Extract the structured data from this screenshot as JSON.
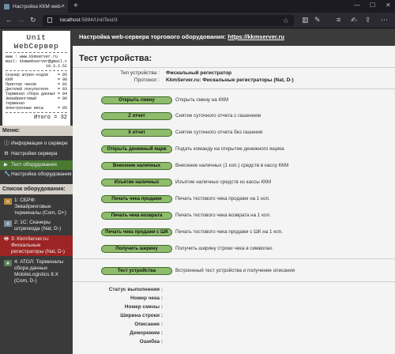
{
  "browser": {
    "tab_title": "Настройка ККМ web-се",
    "url_host": "localhost",
    "url_path": ":5894/UnitTest/3"
  },
  "header": {
    "prefix": "Настройка web-сервера торгового оборудования: ",
    "link": "https://kkmserver.ru"
  },
  "receipt": {
    "title": "Unit WebСервер",
    "lines": [
      "www : www.kkmserver.ru",
      "mail: kkmwebserver@gmail.com"
    ],
    "version": "10.3.2.51",
    "rows": [
      {
        "label": "Сканер штрих-кодов",
        "value": "= 05"
      },
      {
        "label": "ККМ",
        "value": "= 08"
      },
      {
        "label": "Принтер чеков",
        "value": "= 01"
      },
      {
        "label": "Дисплей покупателя",
        "value": "= 03"
      },
      {
        "label": "Терминал сбора данных",
        "value": "= 04"
      },
      {
        "label": "Эквайринговый терминал",
        "value": "= 06"
      },
      {
        "label": "Электронные весы",
        "value": "= 05"
      }
    ],
    "total": "Итого = 32"
  },
  "sidebar": {
    "menu_title": "Меню:",
    "menu_items": [
      {
        "label": "Информация о сервере",
        "icon": "info"
      },
      {
        "label": "Настройки сервера",
        "icon": "gear"
      },
      {
        "label": "Тест оборудования",
        "icon": "play"
      },
      {
        "label": "Настройка оборудования",
        "icon": "wrench"
      }
    ],
    "equipment_title": "Список оборудования:",
    "equipment": [
      {
        "label": "1: СБРФ: Эквайринговые терминалы (Com, D+)"
      },
      {
        "label": "2: 1С: Сканеры штрихкода (Nat, D-)"
      },
      {
        "label": "3: KkmServer.ru: Фискальные регистраторы (Nat, D-)"
      },
      {
        "label": "4: АТОЛ: Терминалы сбора данных MobileLogistics 8.X (Com, D-)"
      }
    ]
  },
  "main": {
    "title": "Тест устройства:",
    "device_type_label": "Тип устройства :",
    "device_type_value": "Фискальный регистратор",
    "protocol_label": "Протокол :",
    "protocol_value": "KkmServer.ru: Фискальные регистраторы (Nat, D-)",
    "commands": [
      {
        "label": "Открыть смену",
        "desc": "Открыть смену на ККМ"
      },
      {
        "label": "Z отчет",
        "desc": "Снятие суточного отчета с гашением"
      },
      {
        "label": "X отчет",
        "desc": "Снятие суточного отчета без гашения"
      },
      {
        "label": "Открыть денежный ящик",
        "desc": "Подать команду на открытие денежного ящика"
      },
      {
        "label": "Внесение наличных",
        "desc": "Внесение наличных (1 коп.) средств в кассу ККМ"
      },
      {
        "label": "Изъятие наличных",
        "desc": "Изъятие наличных средств из кассы ККМ"
      },
      {
        "label": "Печать чека продажи",
        "desc": "Печать тестового чека продажи на 1 коп."
      },
      {
        "label": "Печать чека возврата",
        "desc": "Печать тестового чека возврата на 1 коп."
      },
      {
        "label": "Печать чека продажи с ШК",
        "desc": "Печать тестового чека продажи с ШК на 1 коп."
      },
      {
        "label": "Получить ширину",
        "desc": "Получить ширину строки чека в символах."
      }
    ],
    "selftest": {
      "label": "Тест устройства",
      "desc": "Встроенный тест устройства и получение описания"
    },
    "status_fields": [
      "Статус выполнения :",
      "Номер чека :",
      "Номер смены :",
      "Ширина строки :",
      "Описание :",
      "Деморежим :",
      "Ошибка :"
    ]
  },
  "colors": {
    "button": "#8fbc6c",
    "active_menu": "#4a7a32",
    "active_equipment": "#9c2424",
    "header_bg": "#3b3b3b"
  }
}
